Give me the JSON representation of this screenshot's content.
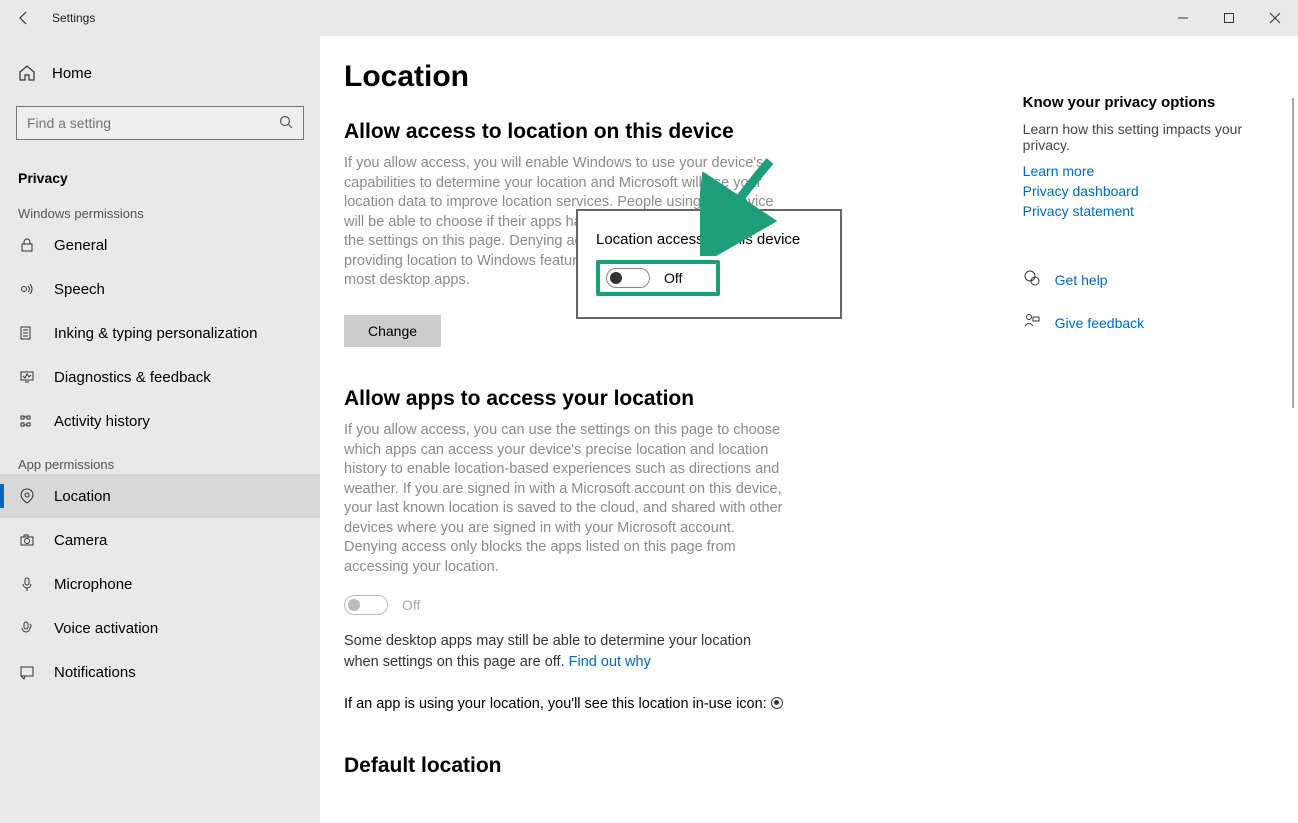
{
  "titlebar": {
    "title": "Settings"
  },
  "sidebar": {
    "home": "Home",
    "search_placeholder": "Find a setting",
    "section": "Privacy",
    "group1": "Windows permissions",
    "items1": [
      {
        "label": "General"
      },
      {
        "label": "Speech"
      },
      {
        "label": "Inking & typing personalization"
      },
      {
        "label": "Diagnostics & feedback"
      },
      {
        "label": "Activity history"
      }
    ],
    "group2": "App permissions",
    "items2": [
      {
        "label": "Location",
        "selected": true
      },
      {
        "label": "Camera"
      },
      {
        "label": "Microphone"
      },
      {
        "label": "Voice activation"
      },
      {
        "label": "Notifications"
      }
    ]
  },
  "page": {
    "title": "Location",
    "section1_heading": "Allow access to location on this device",
    "section1_desc": "If you allow access, you will enable Windows to use your device's capabilities to determine your location and Microsoft will use your location data to improve location services. People using this device will be able to choose if their apps have access to location by using the settings on this page. Denying access blocks Windows from providing location to Windows features, Microsoft Store apps, and most desktop apps.",
    "change_btn": "Change",
    "section2_heading": "Allow apps to access your location",
    "section2_desc": "If you allow access, you can use the settings on this page to choose which apps can access your device's precise location and location history to enable location-based experiences such as directions and weather. If you are signed in with a Microsoft account on this device, your last known location is saved to the cloud, and shared with other devices where you are signed in with your Microsoft account. Denying access only blocks the apps listed on this page from accessing your location.",
    "apps_toggle_label": "Off",
    "desktop_note": "Some desktop apps may still be able to determine your location when settings on this page are off. ",
    "find_out_why": "Find out why",
    "in_use_text": "If an app is using your location, you'll see this location in-use icon: ",
    "section3_heading": "Default location"
  },
  "popup": {
    "title": "Location access for this device",
    "toggle_label": "Off"
  },
  "aside": {
    "heading": "Know your privacy options",
    "desc": "Learn how this setting impacts your privacy.",
    "links": [
      "Learn more",
      "Privacy dashboard",
      "Privacy statement"
    ],
    "help": "Get help",
    "feedback": "Give feedback"
  }
}
